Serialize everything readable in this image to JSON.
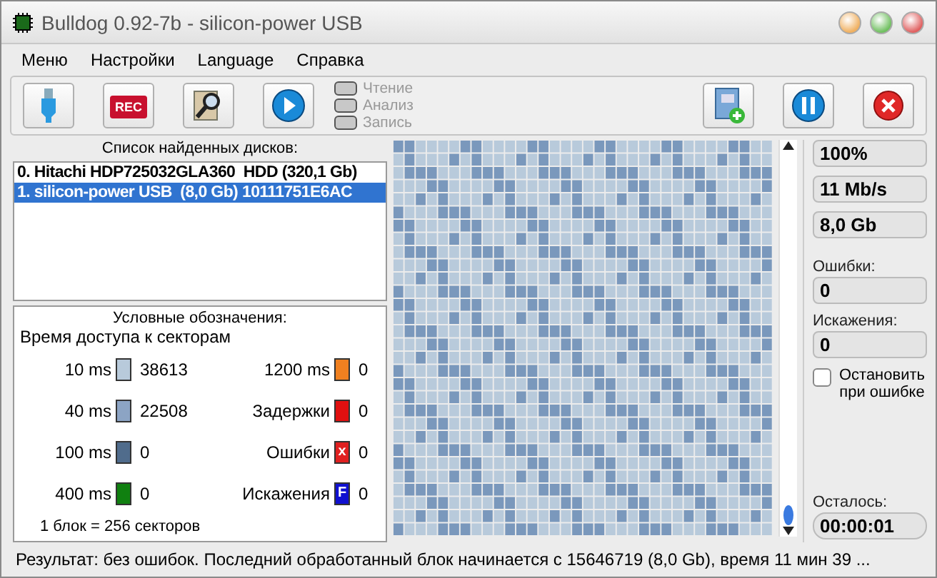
{
  "window": {
    "title": "Bulldog 0.92-7b - silicon-power USB"
  },
  "menu": [
    "Меню",
    "Настройки",
    "Language",
    "Справка"
  ],
  "toolbar": {
    "left": [
      {
        "kind": "usb"
      },
      {
        "kind": "record",
        "text": "REC"
      },
      {
        "kind": "search"
      },
      {
        "kind": "play"
      }
    ],
    "indicators": [
      {
        "label": "Чтение",
        "on": false
      },
      {
        "label": "Анализ",
        "on": false
      },
      {
        "label": "Запись",
        "on": false
      }
    ],
    "right": [
      {
        "kind": "log"
      },
      {
        "kind": "pause"
      },
      {
        "kind": "stop"
      }
    ]
  },
  "disks": {
    "title": "Список найденных дисков:",
    "items": [
      {
        "label": "0. Hitachi HDP725032GLA360  HDD (320,1 Gb)",
        "selected": false
      },
      {
        "label": "1. silicon-power USB  (8,0 Gb) 10111751E6AC",
        "selected": true
      }
    ]
  },
  "legend": {
    "title": "Условные обозначения:",
    "subtitle": "Время доступа к секторам",
    "entries": [
      {
        "label": "10 ms",
        "color": "#b8cadb",
        "count": "38613"
      },
      {
        "label": "1200 ms",
        "color": "#f08020",
        "count": "0"
      },
      {
        "label": "40 ms",
        "color": "#8ca4c4",
        "count": "22508"
      },
      {
        "label": "Задержки",
        "color": "#e01010",
        "count": "0"
      },
      {
        "label": "100 ms",
        "color": "#506c8c",
        "count": "0"
      },
      {
        "label": "Ошибки",
        "color": "#e02020",
        "count": "0",
        "symbol": "x"
      },
      {
        "label": "400 ms",
        "color": "#108010",
        "count": "0"
      },
      {
        "label": "Искажения",
        "color": "#1010d0",
        "count": "0",
        "symbol": "F"
      }
    ],
    "footer": "1 блок = 256 секторов"
  },
  "stats": {
    "fields": [
      {
        "value": "100%"
      },
      {
        "value": "11 Mb/s"
      },
      {
        "value": "8,0 Gb"
      },
      {
        "label": "Ошибки:",
        "value": "0"
      },
      {
        "label": "Искажения:",
        "value": "0"
      }
    ],
    "stop_on_error": {
      "label": "Остановить при ошибке",
      "checked": false
    },
    "remaining": {
      "label": "Осталось:",
      "value": "00:00:01"
    }
  },
  "status": "Результат: без ошибок. Последний обработанный блок начинается с 15646719 (8,0 Gb), время 11 мин 39 ..."
}
